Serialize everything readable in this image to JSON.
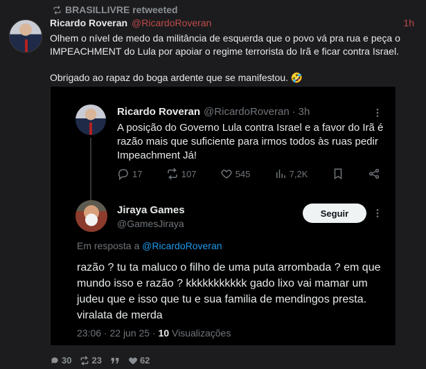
{
  "retweet": {
    "label": "BRASILLIVRE retweeted"
  },
  "tweet": {
    "author_name": "Ricardo Roveran",
    "author_handle": "@RicardoRoveran",
    "time": "1h",
    "paragraph1": "Olhem o nível de medo da militância de esquerda que o povo vá pra rua e peça o IMPEACHMENT do Lula por apoiar o regime terrorista do Irã e ficar contra Israel.",
    "paragraph2": "Obrigado ao rapaz do boga ardente que se manifestou. 🤣"
  },
  "quoted": {
    "author_name": "Ricardo Roveran",
    "author_handle": "@RicardoRoveran",
    "dot": "·",
    "time": "3h",
    "text": "A posição do Governo Lula contra Israel e a favor do Irã é razão mais que suficiente para irmos todos às ruas pedir Impeachment Já!",
    "replies": "17",
    "reposts": "107",
    "likes": "545",
    "views": "7,2K"
  },
  "reply": {
    "author_name": "Jiraya Games",
    "author_handle": "@GamesJiraya",
    "follow_label": "Seguir",
    "reply_to_prefix": "Em resposta a",
    "reply_to_handle": "@RicardoRoveran",
    "text": "razão ? tu ta maluco o filho de uma puta arrombada ? em que mundo isso e razão ? kkkkkkkkkkk gado lixo vai mamar um judeu que e isso que tu e sua familia de mendingos presta. viralata de merda",
    "timestamp": "23:06 · 22 jun 25 · ",
    "views_count": "10",
    "views_label": "Visualizações"
  },
  "stats": {
    "replies": "30",
    "reposts": "23",
    "quotes_icon": "quote-icon",
    "likes": "62"
  },
  "colors": {
    "background": "#1c1c1e",
    "embed_background": "#000000",
    "handle_red": "#c04a4a",
    "link_blue": "#1d9bf0",
    "muted": "#71767b"
  }
}
